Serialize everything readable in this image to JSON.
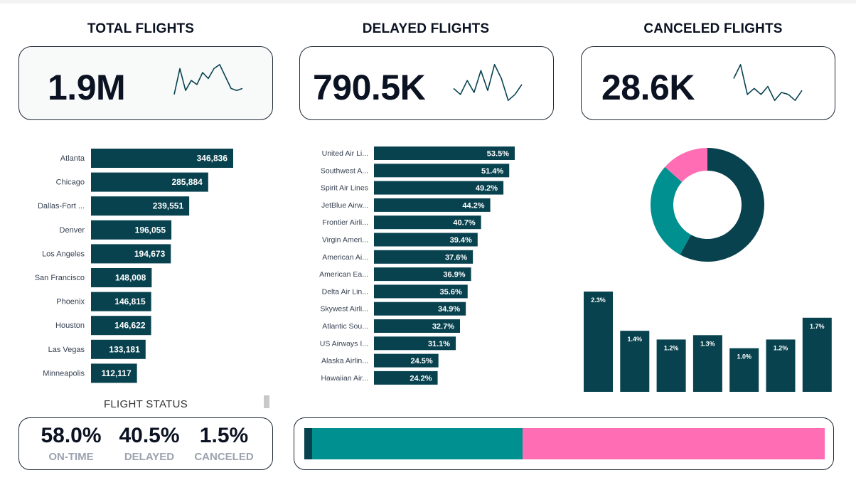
{
  "colors": {
    "dark": "#08424f",
    "teal": "#00908f",
    "pink": "#ff6eb4",
    "text": "#0b1222",
    "muted": "#9ca3af"
  },
  "kpis": [
    {
      "title": "TOTAL FLIGHTS",
      "value": "1.9M",
      "spark": [
        0.2,
        0.85,
        0.3,
        0.55,
        0.45,
        0.75,
        0.6,
        0.85,
        0.95,
        0.65,
        0.35,
        0.3,
        0.35
      ]
    },
    {
      "title": "DELAYED FLIGHTS",
      "value": "790.5K",
      "spark": [
        0.35,
        0.2,
        0.55,
        0.25,
        0.8,
        0.3,
        0.95,
        0.6,
        0.05,
        0.2,
        0.45
      ]
    },
    {
      "title": "CANCELED FLIGHTS",
      "value": "28.6K",
      "spark": [
        0.6,
        0.95,
        0.2,
        0.35,
        0.2,
        0.4,
        0.05,
        0.25,
        0.2,
        0.05,
        0.3
      ]
    }
  ],
  "chart_data": [
    {
      "type": "bar",
      "orientation": "horizontal",
      "categories": [
        "Atlanta",
        "Chicago",
        "Dallas-Fort ...",
        "Denver",
        "Los Angeles",
        "San Francisco",
        "Phoenix",
        "Houston",
        "Las Vegas",
        "Minneapolis"
      ],
      "values": [
        346836,
        285884,
        239551,
        196055,
        194673,
        148008,
        146815,
        146622,
        133181,
        112117
      ],
      "labels": [
        "346,836",
        "285,884",
        "239,551",
        "196,055",
        "194,673",
        "148,008",
        "146,815",
        "146,622",
        "133,181",
        "112,117"
      ]
    },
    {
      "type": "bar",
      "orientation": "horizontal",
      "categories": [
        "United Air Li...",
        "Southwest A...",
        "Spirit Air Lines",
        "JetBlue Airw...",
        "Frontier Airli...",
        "Virgin Ameri...",
        "American Ai...",
        "American Ea...",
        "Delta Air Lin...",
        "Skywest Airli...",
        "Atlantic Sou...",
        "US Airways I...",
        "Alaska Airlin...",
        "Hawaiian Air..."
      ],
      "values": [
        53.5,
        51.4,
        49.2,
        44.2,
        40.7,
        39.4,
        37.6,
        36.9,
        35.6,
        34.9,
        32.7,
        31.1,
        24.5,
        24.2
      ],
      "labels": [
        "53.5%",
        "51.4%",
        "49.2%",
        "44.2%",
        "40.7%",
        "39.4%",
        "37.6%",
        "36.9%",
        "35.6%",
        "34.9%",
        "32.7%",
        "31.1%",
        "24.5%",
        "24.2%"
      ]
    },
    {
      "type": "pie",
      "donut": true,
      "values": [
        58.0,
        28.6,
        13.4
      ],
      "colors": [
        "#08424f",
        "#00908f",
        "#ff6eb4"
      ]
    },
    {
      "type": "bar",
      "orientation": "vertical",
      "values": [
        2.3,
        1.4,
        1.2,
        1.3,
        1.0,
        1.2,
        1.7
      ],
      "labels": [
        "2.3%",
        "1.4%",
        "1.2%",
        "1.3%",
        "1.0%",
        "1.2%",
        "1.7%"
      ]
    },
    {
      "type": "bar",
      "orientation": "stacked-horizontal",
      "values": [
        1.5,
        40.5,
        58.0
      ],
      "colors": [
        "#08424f",
        "#00908f",
        "#ff6eb4"
      ]
    }
  ],
  "status": {
    "title": "FLIGHT STATUS",
    "items": [
      {
        "value": "58.0%",
        "label": "ON-TIME"
      },
      {
        "value": "40.5%",
        "label": "DELAYED"
      },
      {
        "value": "1.5%",
        "label": "CANCELED"
      }
    ]
  }
}
